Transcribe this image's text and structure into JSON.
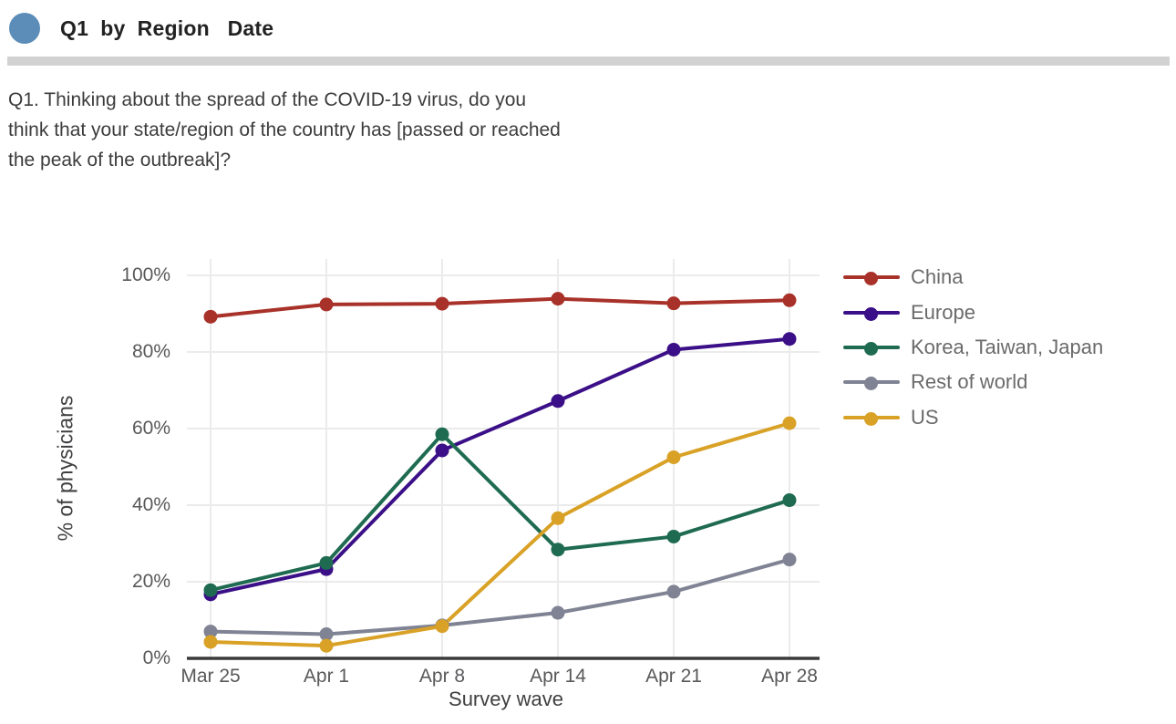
{
  "header": {
    "dot_color": "#5b8db8",
    "title": "Q1  by  Region   Date"
  },
  "question": {
    "text": "Q1. Thinking about the spread of the COVID-19 virus, do you\nthink that your state/region of the country has [passed or reached\nthe peak of the outbreak]?"
  },
  "chart_data": {
    "type": "line",
    "title": "",
    "xlabel": "Survey wave",
    "ylabel": "% of physicians",
    "categories": [
      "Mar 25",
      "Apr 1",
      "Apr 8",
      "Apr 14",
      "Apr 21",
      "Apr 28"
    ],
    "ylim": [
      0,
      100
    ],
    "yticks": [
      0,
      20,
      40,
      60,
      80,
      100
    ],
    "ytick_labels": [
      "0%",
      "20%",
      "40%",
      "60%",
      "80%",
      "100%"
    ],
    "grid": true,
    "legend_position": "right",
    "series": [
      {
        "name": "China",
        "color": "#a8322a",
        "values": [
          89.2,
          92.4,
          92.6,
          93.9,
          92.7,
          93.5
        ]
      },
      {
        "name": "Europe",
        "color": "#3b0f87",
        "values": [
          16.7,
          23.3,
          54.3,
          67.2,
          80.6,
          83.4
        ]
      },
      {
        "name": "Korea, Taiwan, Japan",
        "color": "#1f6b52",
        "values": [
          17.8,
          24.9,
          58.5,
          28.4,
          31.8,
          41.3
        ]
      },
      {
        "name": "Rest of world",
        "color": "#7f8393",
        "values": [
          7.0,
          6.3,
          8.6,
          11.9,
          17.4,
          25.8
        ]
      },
      {
        "name": "US",
        "color": "#d9a227",
        "values": [
          4.3,
          3.3,
          8.4,
          36.6,
          52.5,
          61.4
        ]
      }
    ]
  },
  "axis": {
    "color": "#3a3a3a",
    "gridline_color": "#ebebeb"
  }
}
